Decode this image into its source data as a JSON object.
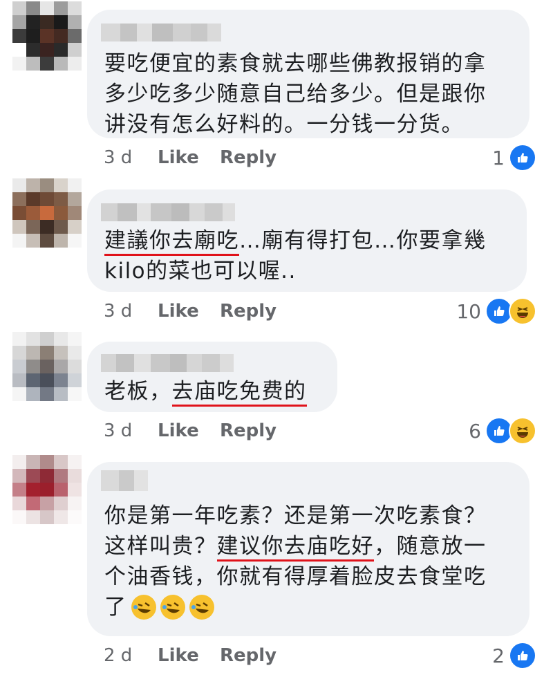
{
  "comments": [
    {
      "lines": [
        "要吃便宜的素食就去哪些佛教报销的拿",
        "多少吃多少随意自己给多少。但是跟你",
        "讲没有怎么好料的。一分钱一分货。"
      ],
      "time": "3 d",
      "like": "Like",
      "reply": "Reply",
      "reactions": "1",
      "reaction_types": [
        "like-icon"
      ]
    },
    {
      "line1_underlined": "建議你去廟吃",
      "line1_rest": "…廟有得打包…你要拿幾",
      "line2": "kilo的菜也可以喔..",
      "time": "3 d",
      "like": "Like",
      "reply": "Reply",
      "reactions": "10",
      "reaction_types": [
        "like-icon",
        "haha-icon"
      ]
    },
    {
      "line1_prefix": "老板，",
      "line1_underlined": "去庙吃免费的",
      "time": "3 d",
      "like": "Like",
      "reply": "Reply",
      "reactions": "6",
      "reaction_types": [
        "like-icon",
        "haha-icon"
      ]
    },
    {
      "line1": "你是第一年吃素？还是第一次吃素食？",
      "line2_prefix": "这样叫贵？",
      "line2_underlined": "建议你去庙吃好",
      "line2_rest": "，随意放一",
      "line3": "个油香钱，你就有得厚着脸皮去食堂吃",
      "line4": "了",
      "emojis": [
        "rofl-emoji",
        "rofl-emoji",
        "rofl-emoji"
      ],
      "time": "2 d",
      "like": "Like",
      "reply": "Reply",
      "reactions": "2",
      "reaction_types": [
        "like-icon"
      ]
    }
  ],
  "colors": {
    "bubble": "#f0f2f5",
    "meta": "#65676b",
    "underline": "#e0121a",
    "like_blue": "#1877f2",
    "haha_yellow": "#f7c12e"
  }
}
